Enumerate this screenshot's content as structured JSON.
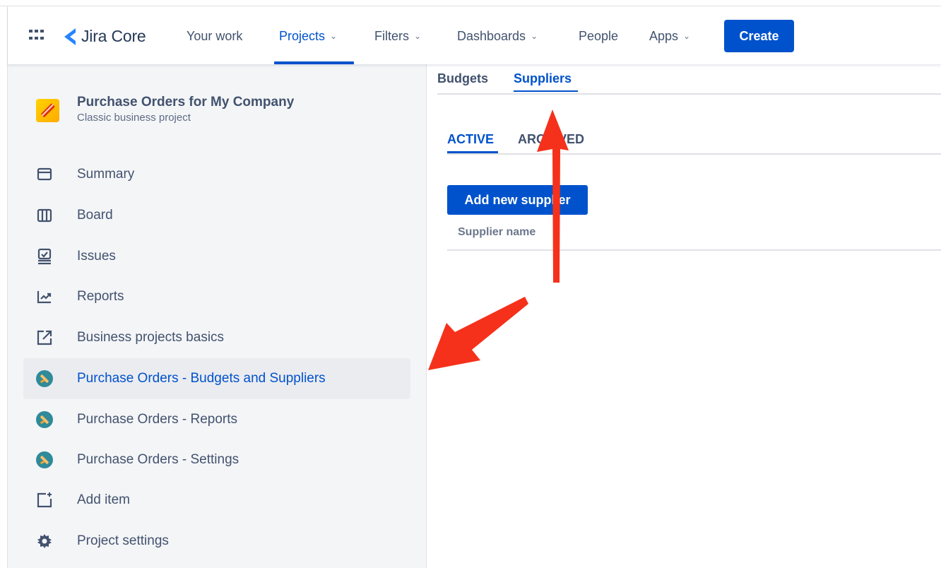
{
  "topnav": {
    "logo_text": "Jira Core",
    "items": [
      {
        "label": "Your work",
        "chevron": false
      },
      {
        "label": "Projects",
        "chevron": true
      },
      {
        "label": "Filters",
        "chevron": true
      },
      {
        "label": "Dashboards",
        "chevron": true
      },
      {
        "label": "People",
        "chevron": false
      },
      {
        "label": "Apps",
        "chevron": true
      }
    ],
    "active_item": "Projects",
    "create_label": "Create",
    "chevron_glyph": "⌄"
  },
  "sidebar": {
    "project_name": "Purchase Orders for My Company",
    "project_type": "Classic business project",
    "items": [
      {
        "label": "Summary",
        "icon": "summary-icon"
      },
      {
        "label": "Board",
        "icon": "board-icon"
      },
      {
        "label": "Issues",
        "icon": "issues-icon"
      },
      {
        "label": "Reports",
        "icon": "reports-icon"
      },
      {
        "label": "Business projects basics",
        "icon": "external-link-icon"
      },
      {
        "label": "Purchase Orders - Budgets and Suppliers",
        "icon": "app-icon",
        "selected": true
      },
      {
        "label": "Purchase Orders - Reports",
        "icon": "app-icon"
      },
      {
        "label": "Purchase Orders - Settings",
        "icon": "app-icon"
      },
      {
        "label": "Add item",
        "icon": "add-item-icon"
      },
      {
        "label": "Project settings",
        "icon": "gear-icon"
      }
    ]
  },
  "main": {
    "tabs": [
      "Budgets",
      "Suppliers"
    ],
    "active_tab": "Suppliers",
    "subtabs": [
      "ACTIVE",
      "ARCHIVED"
    ],
    "active_subtab": "ACTIVE",
    "add_button": "Add new supplier",
    "table_columns": [
      "Supplier name"
    ]
  },
  "colors": {
    "accent": "#0052cc",
    "annotation_arrow": "#f5311b"
  }
}
